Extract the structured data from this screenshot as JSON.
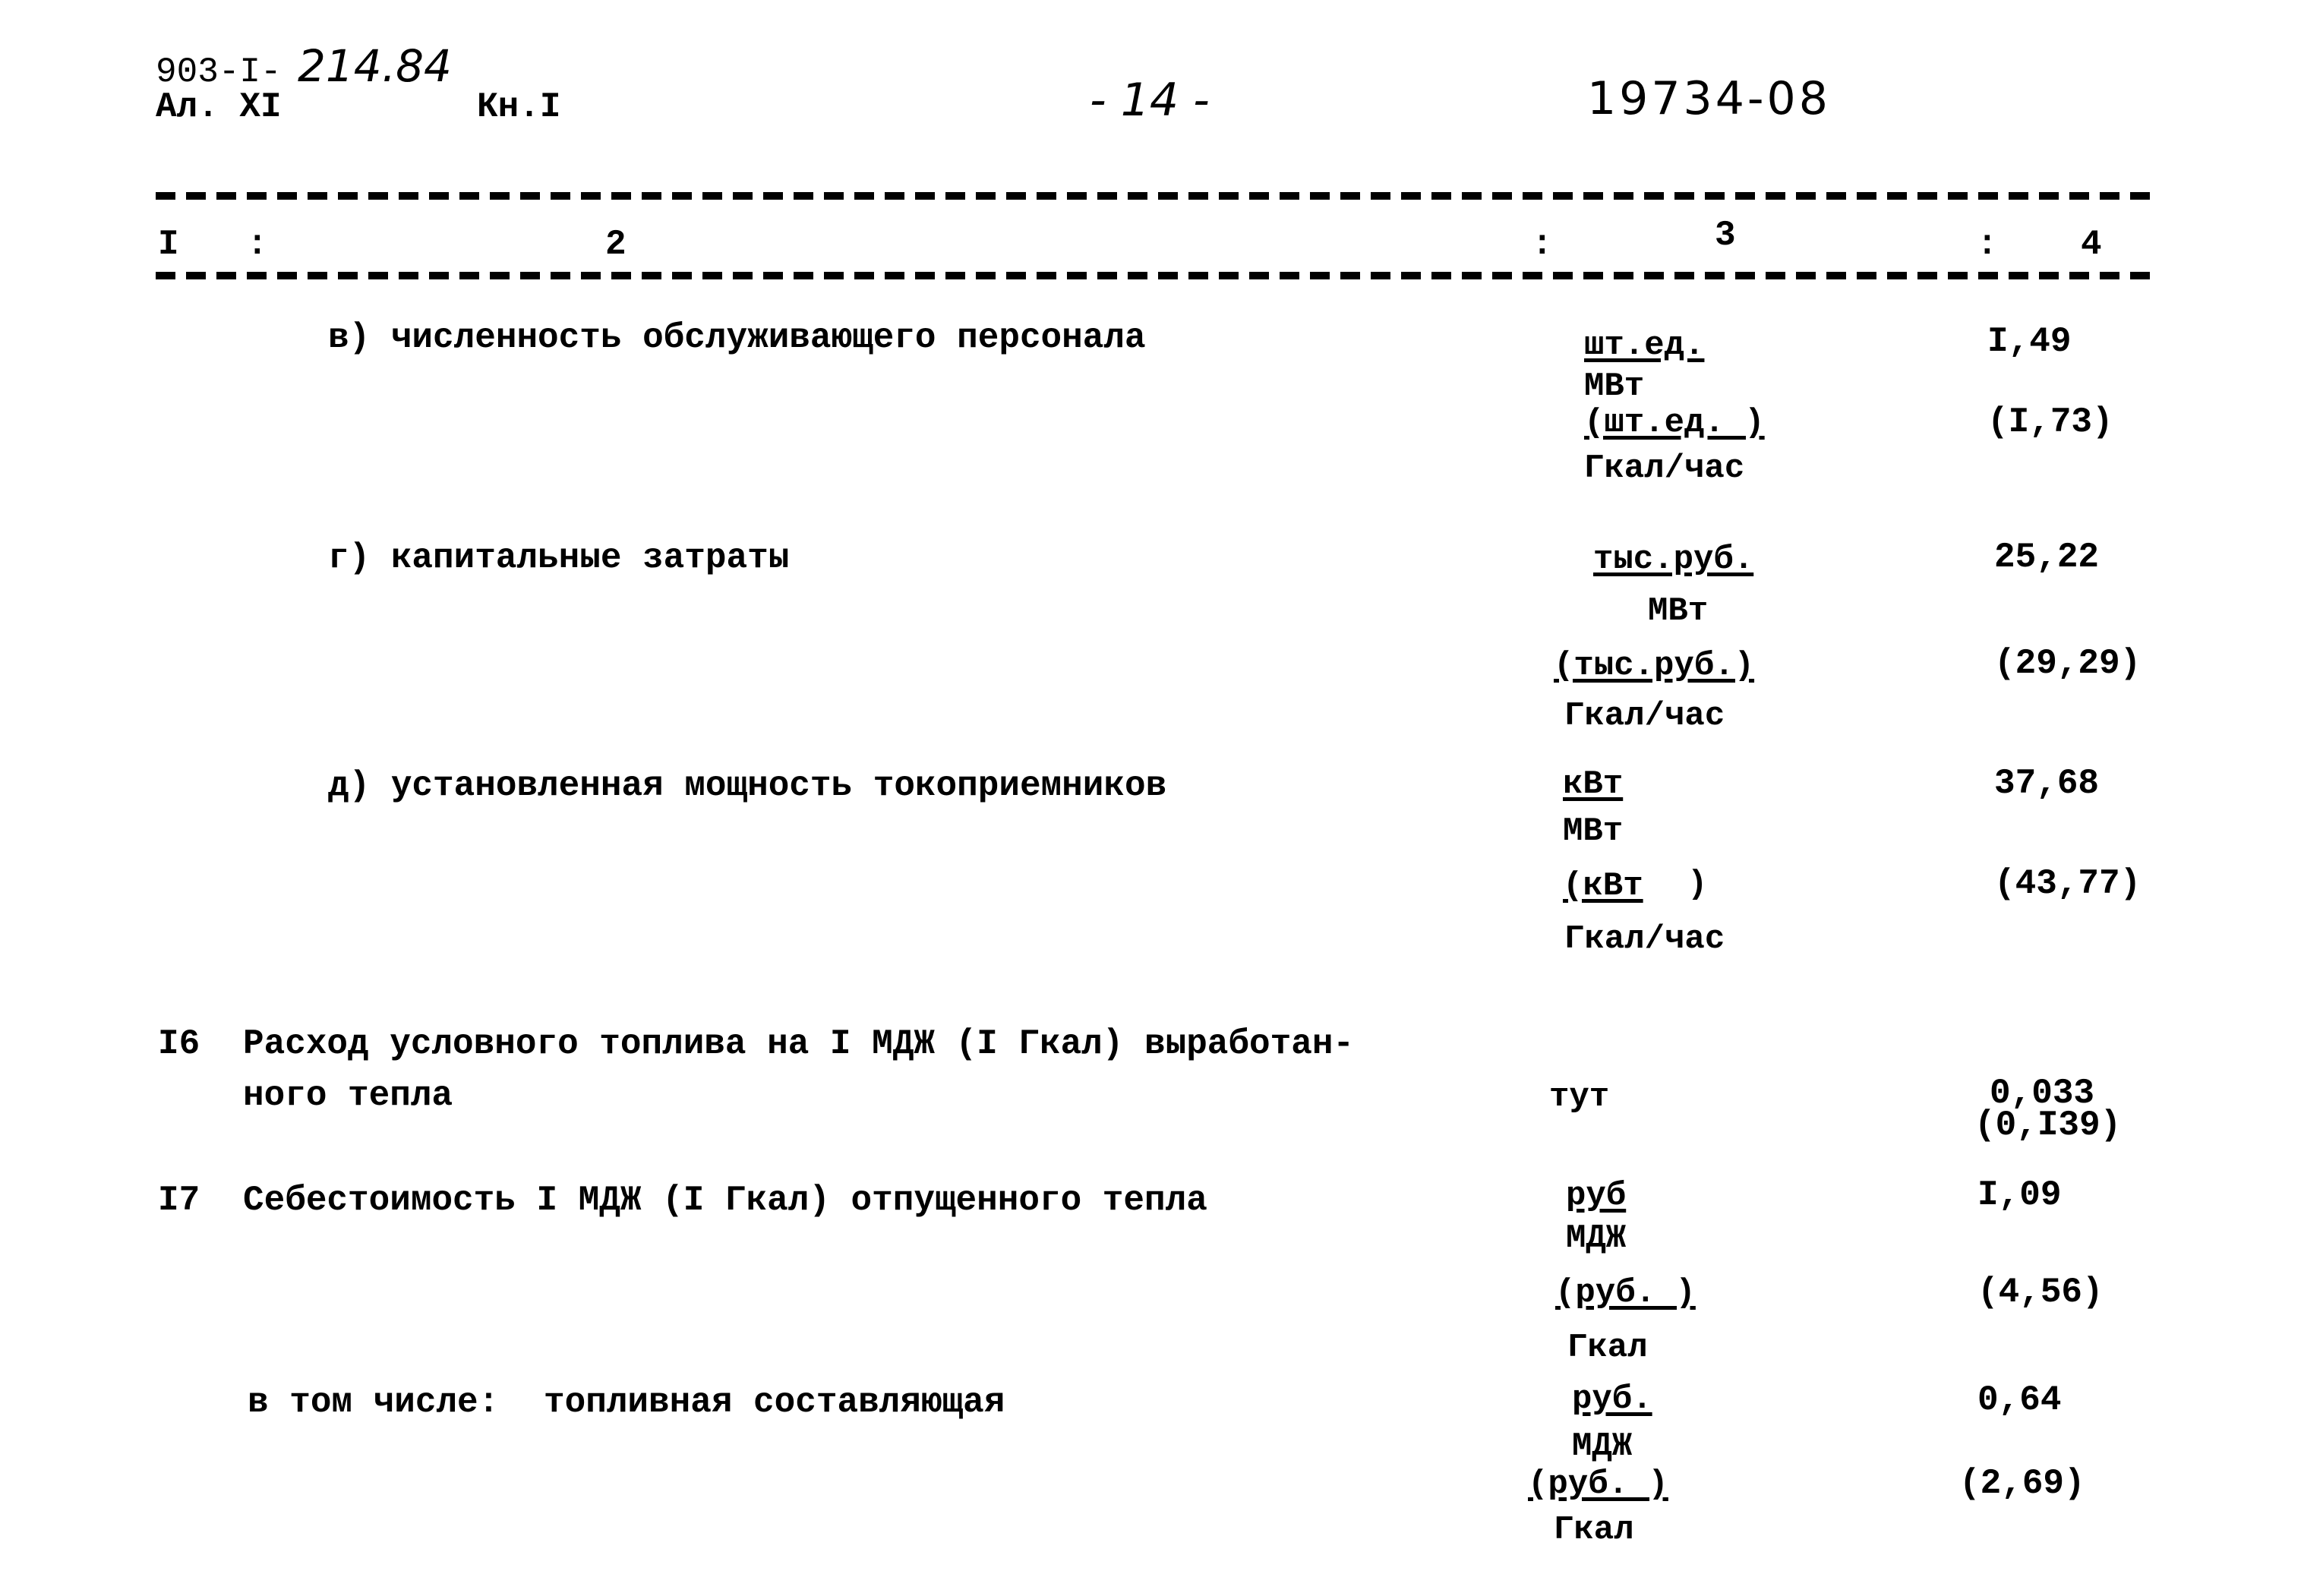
{
  "header": {
    "doc_code_prefix": "903-I-",
    "doc_code_handwritten": "214.84",
    "album": "Ал. XI",
    "book": "Кн.I",
    "page_number": "- 14 -",
    "archive_number": "19734-08"
  },
  "table_header": {
    "col1": "I",
    "col2": "2",
    "col3": "3",
    "col4": "4",
    "separator": ":"
  },
  "rows": [
    {
      "label": "в) численность обслуживающего персонала",
      "unit_num": "шт.ед.",
      "unit_den": "МВт",
      "unit_num_alt": "(шт.ед. )",
      "unit_den_alt": "Гкал/час",
      "value": "I,49",
      "value_alt": "(I,73)"
    },
    {
      "label": "г) капитальные затраты",
      "unit_num": "тыс.руб.",
      "unit_den": "МВт",
      "unit_num_alt": "(тыс.руб.)",
      "unit_den_alt": "Гкал/час",
      "value": "25,22",
      "value_alt": "(29,29)"
    },
    {
      "label": "д) установленная мощность токоприемников",
      "unit_num": "кВт",
      "unit_den": "МВт",
      "unit_num_alt": "(кВт",
      "unit_num_alt_close": ")",
      "unit_den_alt": "Гкал/час",
      "value": "37,68",
      "value_alt": "(43,77)"
    },
    {
      "number": "I6",
      "label_line1": "Расход условного топлива на I МДЖ (I Гкал) выработан-",
      "label_line2": "ного тепла",
      "unit": "тут",
      "value": "0,033",
      "value_alt": "(0,I39)"
    },
    {
      "number": "I7",
      "label": "Себестоимость I МДЖ (I Гкал) отпущенного тепла",
      "unit_num": "руб",
      "unit_den": "МДЖ",
      "unit_num_alt": "(руб. )",
      "unit_den_alt": "Гкал",
      "value": "I,09",
      "value_alt": "(4,56)"
    },
    {
      "label_prefix": "в том числе:",
      "label": "топливная составляющая",
      "unit_num": "руб.",
      "unit_den": "МДЖ",
      "unit_num_alt": "(руб. )",
      "unit_den_alt": "Гкал",
      "value": "0,64",
      "value_alt": "(2,69)"
    }
  ]
}
